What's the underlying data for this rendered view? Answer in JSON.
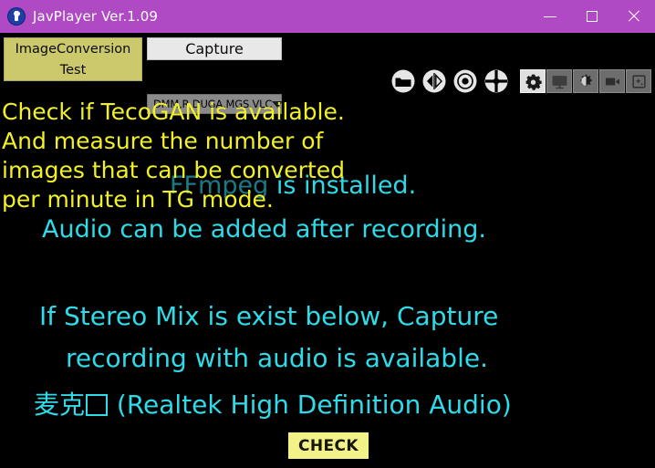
{
  "window": {
    "title": "JavPlayer Ver.1.09",
    "app_icon": "javplayer-logo-icon",
    "titlebar_color": "#b04ac4",
    "controls": {
      "minimize": "minimize-icon",
      "maximize": "maximize-icon",
      "close": "close-icon"
    }
  },
  "toolbar": {
    "mode_button": {
      "line1": "ImageConversion",
      "line2": "Test",
      "color": "#cbc96b"
    },
    "capture_button": "Capture",
    "site_select": {
      "value": "DMM,R,DUGA,MGS,VLC",
      "caret": "chevron-down-icon"
    },
    "icons": [
      {
        "name": "folder-icon",
        "shape": "circle"
      },
      {
        "name": "mirror-flip-icon",
        "shape": "circle"
      },
      {
        "name": "record-icon",
        "shape": "circle"
      },
      {
        "name": "disc-icon",
        "shape": "circle"
      },
      {
        "name": "gear-icon",
        "shape": "square",
        "active": true
      },
      {
        "name": "monitor-icon",
        "shape": "square",
        "active": false
      },
      {
        "name": "contrast-icon",
        "shape": "square",
        "active": false
      },
      {
        "name": "video-camera-icon",
        "shape": "square",
        "active": false
      },
      {
        "name": "image-enhance-icon",
        "shape": "square",
        "active": false
      }
    ]
  },
  "content": {
    "notice_yellow": [
      "Check if TecoGAN is available.",
      "And measure the number of",
      "images that can be converted",
      "per minute in TG mode."
    ],
    "ffmpeg_status_dim": "FFmpeg",
    "ffmpeg_status_bright": " is installed.",
    "audio_note": "Audio can be added after recording.",
    "stereo_note_line1": "If Stereo Mix is exist below, Capture",
    "stereo_note_line2": "recording with audio is available.",
    "device_prefix": "麦克",
    "device_suffix": " (Realtek High Definition Audio)",
    "check_button": "CHECK",
    "colors": {
      "yellow_text": "#f2f223",
      "cyan_text": "#2fdbe8",
      "cyan_dim": "#1a7a86",
      "background": "#000000",
      "check_button_bg": "#f2f289"
    }
  }
}
